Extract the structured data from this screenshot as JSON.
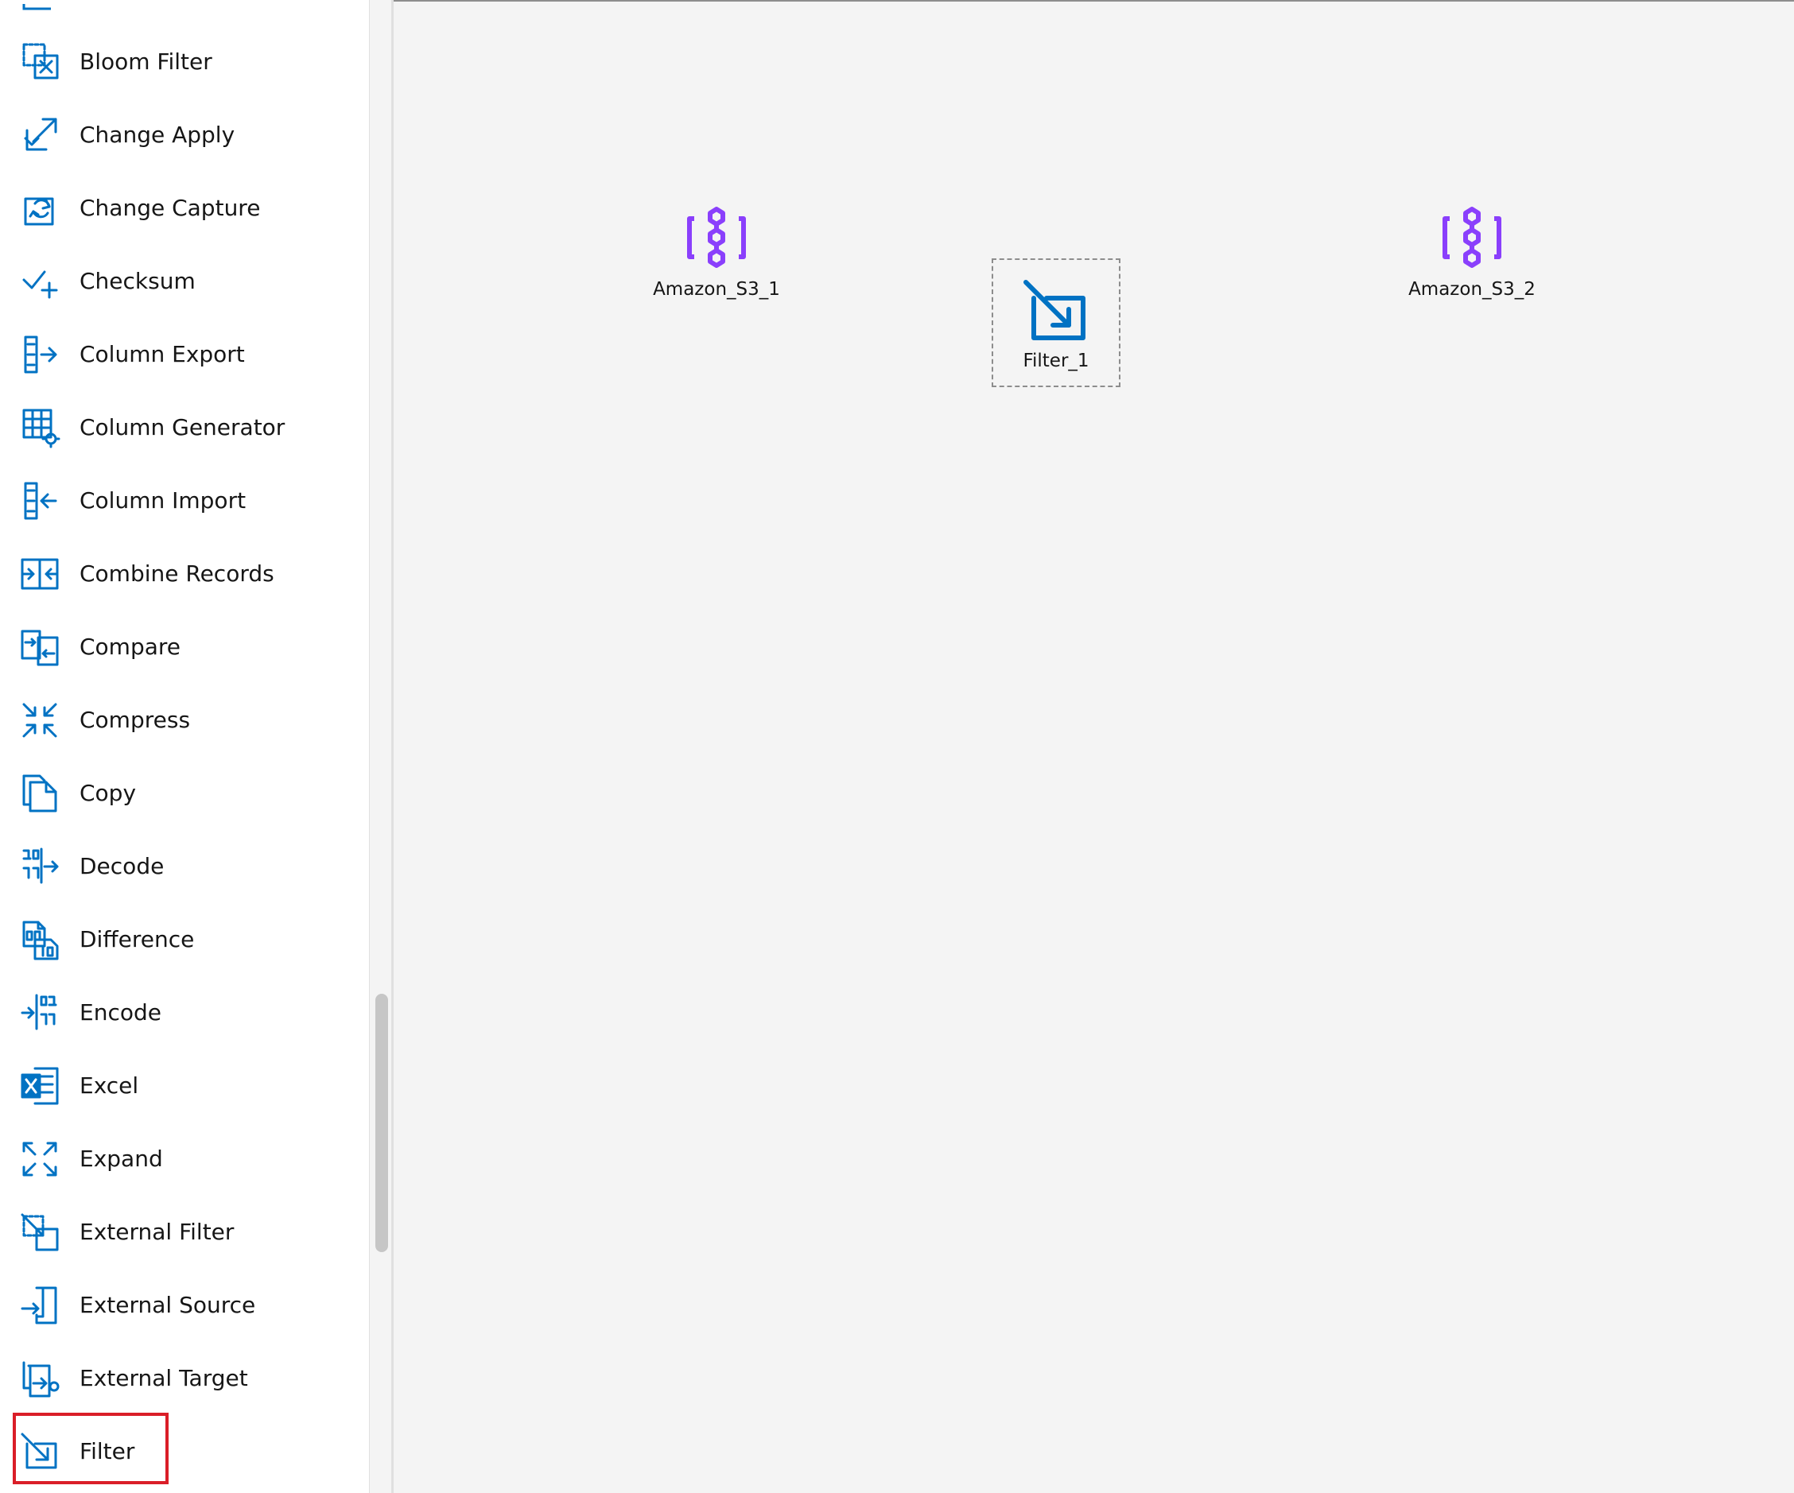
{
  "palette": {
    "items": [
      {
        "label": "Bloom Filter",
        "icon": "bloom-filter-icon"
      },
      {
        "label": "Change Apply",
        "icon": "change-apply-icon"
      },
      {
        "label": "Change Capture",
        "icon": "change-capture-icon"
      },
      {
        "label": "Checksum",
        "icon": "checksum-icon"
      },
      {
        "label": "Column Export",
        "icon": "column-export-icon"
      },
      {
        "label": "Column Generator",
        "icon": "column-generator-icon"
      },
      {
        "label": "Column Import",
        "icon": "column-import-icon"
      },
      {
        "label": "Combine Records",
        "icon": "combine-records-icon"
      },
      {
        "label": "Compare",
        "icon": "compare-icon"
      },
      {
        "label": "Compress",
        "icon": "compress-icon"
      },
      {
        "label": "Copy",
        "icon": "copy-icon"
      },
      {
        "label": "Decode",
        "icon": "decode-icon"
      },
      {
        "label": "Difference",
        "icon": "difference-icon"
      },
      {
        "label": "Encode",
        "icon": "encode-icon"
      },
      {
        "label": "Excel",
        "icon": "excel-icon"
      },
      {
        "label": "Expand",
        "icon": "expand-icon"
      },
      {
        "label": "External Filter",
        "icon": "external-filter-icon"
      },
      {
        "label": "External Source",
        "icon": "external-source-icon"
      },
      {
        "label": "External Target",
        "icon": "external-target-icon"
      },
      {
        "label": "Filter",
        "icon": "filter-icon"
      }
    ],
    "highlighted_item": "Filter"
  },
  "canvas": {
    "nodes": [
      {
        "label": "Amazon_S3_1",
        "icon": "amazon-s3-icon"
      },
      {
        "label": "Filter_1",
        "icon": "filter-icon",
        "selected": true
      },
      {
        "label": "Amazon_S3_2",
        "icon": "amazon-s3-icon"
      }
    ]
  },
  "colors": {
    "icon_blue": "#0f62fe",
    "icon_stage_blue": "#0072c3",
    "s3_purple": "#8a3ffc",
    "highlight_red": "#da1e28",
    "canvas_bg": "#f4f4f4"
  }
}
